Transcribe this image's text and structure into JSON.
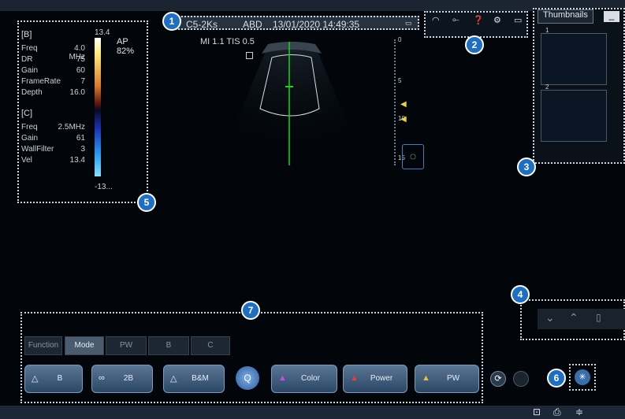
{
  "header": {
    "probe": "C5-2Ks",
    "preset": "ABD",
    "datetime": "13/01/2020 14:49:35"
  },
  "status_icons": [
    "wifi-icon",
    "usb-icon",
    "help-icon",
    "gear-icon",
    "monitor-icon"
  ],
  "image_info": {
    "mi_tis": "MI 1.1 TIS 0.5",
    "ap": "AP 82%"
  },
  "params": {
    "b_title": "[B]",
    "b": [
      [
        "Freq",
        "4.0 MHz"
      ],
      [
        "DR",
        "75"
      ],
      [
        "Gain",
        "60"
      ],
      [
        "FrameRate",
        "7"
      ],
      [
        "Depth",
        "16.0"
      ]
    ],
    "c_title": "[C]",
    "c": [
      [
        "Freq",
        "2.5MHz"
      ],
      [
        "Gain",
        "61"
      ],
      [
        "WallFilter",
        "3"
      ],
      [
        "Vel",
        "13.4"
      ]
    ],
    "scale_top": "13.4",
    "scale_bottom": "-13..."
  },
  "depth_scale": [
    "0",
    "5",
    "10",
    "15"
  ],
  "thumbnails": {
    "title": "Thumbnails",
    "items": [
      "1",
      "2"
    ]
  },
  "callouts": [
    "1",
    "2",
    "3",
    "4",
    "5",
    "6",
    "7"
  ],
  "tabs": [
    "Function",
    "Mode",
    "PW",
    "B",
    "C"
  ],
  "mode_buttons": [
    {
      "label": "B",
      "icon": "B-mode"
    },
    {
      "label": "2B",
      "icon": "dual"
    },
    {
      "label": "B&M",
      "icon": "bm"
    },
    {
      "label": "Color",
      "icon": "color"
    },
    {
      "label": "Power",
      "icon": "power"
    },
    {
      "label": "PW",
      "icon": "pw"
    }
  ],
  "q_label": "Q"
}
